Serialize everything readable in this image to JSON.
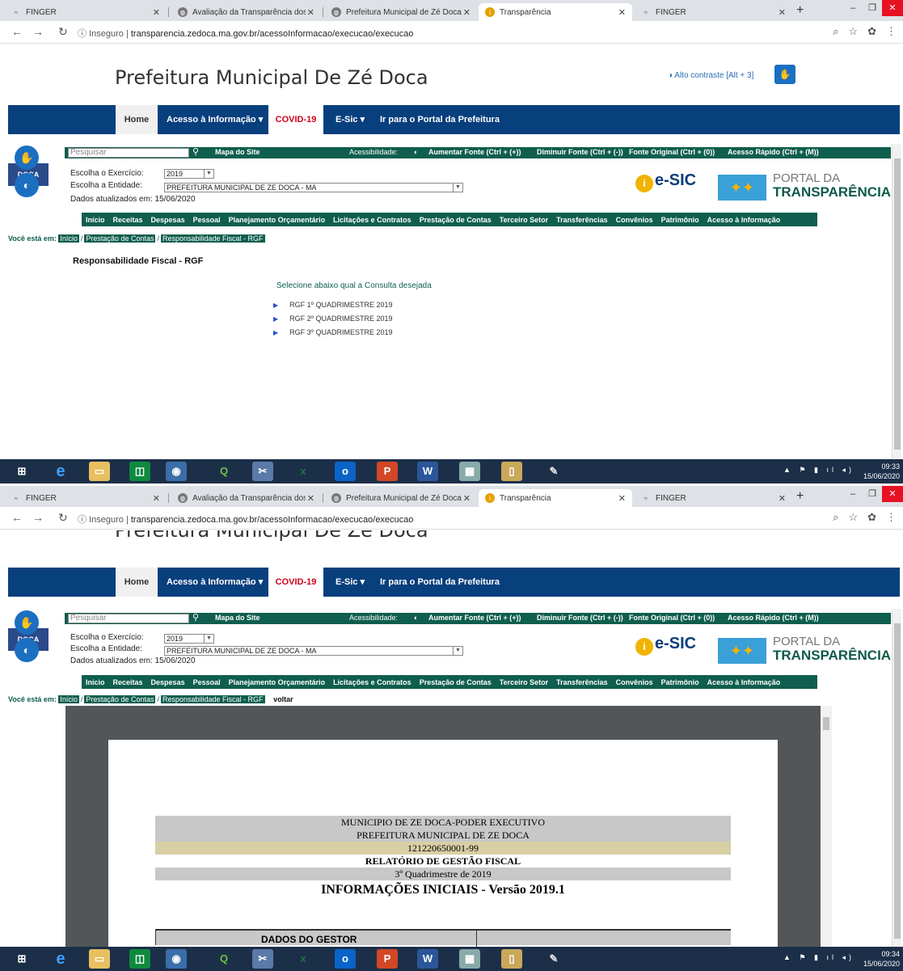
{
  "browser": {
    "tabs": [
      {
        "title": "FINGER",
        "icon": "finger-icon"
      },
      {
        "title": "Avaliação da Transparência dos",
        "icon": "globe-icon"
      },
      {
        "title": "Prefeitura Municipal de Zé Doca",
        "icon": "globe-icon"
      },
      {
        "title": "Transparência",
        "icon": "info-icon"
      },
      {
        "title": "FINGER",
        "icon": "finger-icon"
      }
    ],
    "new_tab": "+",
    "url_prefix": "Inseguro",
    "url_separator": "|",
    "url": "transparencia.zedoca.ma.gov.br/acessoInformacao/execucao/execucao"
  },
  "site": {
    "title": "Prefeitura Municipal De Zé Doca",
    "contrast": "Alto contraste [Alt + 3]",
    "main_nav": [
      "Home",
      "Acesso à Informação ▾",
      "COVID-19",
      "E-Sic ▾",
      "Ir para o Portal da Prefeitura"
    ]
  },
  "portal": {
    "search_placeholder": "Pesquisar",
    "site_map": "Mapa do Site",
    "accessibility": "Acessibilidade:",
    "increase_font": "Aumentar Fonte (Ctrl + (+))",
    "decrease_font": "Diminuir Fonte (Ctrl + (-))",
    "original_font": "Fonte Original (Ctrl + (0))",
    "quick_access": "Acesso Rápido (Ctrl + (M))",
    "year_label": "Escolha o Exercício:",
    "year_value": "2019",
    "entity_label": "Escolha a Entidade:",
    "entity_value": "PREFEITURA MUNICIPAL DE ZE DOCA - MA",
    "updated": "Dados atualizados em: 15/06/2020",
    "city_logo": "DOCA",
    "esic": "e-SIC",
    "portal_line1": "PORTAL DA",
    "portal_line2": "TRANSPARÊNCIA",
    "sec_nav": [
      "Início",
      "Receitas",
      "Despesas",
      "Pessoal",
      "Planejamento Orçamentário",
      "Licitações e Contratos",
      "Prestação de Contas",
      "Terceiro Setor",
      "Transferências",
      "Convênios",
      "Patrimônio",
      "Acesso à Informação"
    ],
    "breadcrumb_label": "Você está em:",
    "breadcrumb": [
      "Início",
      "Prestação de Contas",
      "Responsabilidade Fiscal - RGF"
    ],
    "back": "voltar"
  },
  "content": {
    "page_title": "Responsabilidade Fiscal - RGF",
    "select_msg": "Selecione abaixo qual a Consulta desejada",
    "reports": [
      "RGF 1º QUADRIMESTRE 2019",
      "RGF 2º QUADRIMESTRE 2019",
      "RGF 3º QUADRIMESTRE 2019"
    ]
  },
  "pdf": {
    "lines": [
      "MUNICIPIO DE ZE DOCA-PODER EXECUTIVO",
      "PREFEITURA MUNICIPAL DE ZE DOCA",
      "121220650001-99",
      "RELATÓRIO DE GESTÃO FISCAL",
      "3º Quadrimestre de 2019",
      "INFORMAÇÕES INICIAIS - Versão 2019.1"
    ],
    "table_header": "DADOS DO GESTOR"
  },
  "taskbar": {
    "times": [
      "09:33",
      "09:34"
    ],
    "date": "15/06/2020",
    "apps": [
      "windows-start-icon",
      "ie-icon",
      "file-explorer-icon",
      "store-icon",
      "chrome-icon",
      "qgis-icon",
      "snipping-icon",
      "excel-icon",
      "outlook-icon",
      "powerpoint-icon",
      "word-icon",
      "calculator-icon",
      "folder-icon",
      "paint-icon"
    ]
  }
}
